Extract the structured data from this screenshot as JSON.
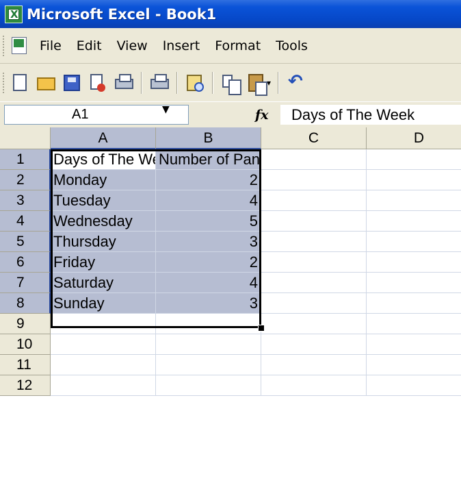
{
  "window": {
    "title": "Microsoft Excel - Book1"
  },
  "menu": {
    "items": [
      "File",
      "Edit",
      "View",
      "Insert",
      "Format",
      "Tools"
    ]
  },
  "toolbar": {
    "buttons": [
      "new-icon",
      "open-icon",
      "save-icon",
      "permission-icon",
      "print-icon",
      "research-icon",
      "copy-icon",
      "paste-icon",
      "undo-icon"
    ]
  },
  "formula_bar": {
    "name_box": "A1",
    "fx_label": "fx",
    "formula": "Days of The Week"
  },
  "sheet": {
    "columns": [
      "A",
      "B",
      "C",
      "D"
    ],
    "rows": [
      "1",
      "2",
      "3",
      "4",
      "5",
      "6",
      "7",
      "8",
      "9",
      "10",
      "11",
      "12"
    ],
    "cells": [
      [
        "Days of The Week",
        "Number of Pancakes",
        "",
        ""
      ],
      [
        "Monday",
        "2",
        "",
        ""
      ],
      [
        "Tuesday",
        "4",
        "",
        ""
      ],
      [
        "Wednesday",
        "5",
        "",
        ""
      ],
      [
        "Thursday",
        "3",
        "",
        ""
      ],
      [
        "Friday",
        "2",
        "",
        ""
      ],
      [
        "Saturday",
        "4",
        "",
        ""
      ],
      [
        "Sunday",
        "3",
        "",
        ""
      ],
      [
        "",
        "",
        "",
        ""
      ],
      [
        "",
        "",
        "",
        ""
      ],
      [
        "",
        "",
        "",
        ""
      ]
    ],
    "selection": "A1:B8",
    "selection_color": "#b6bdd2"
  }
}
